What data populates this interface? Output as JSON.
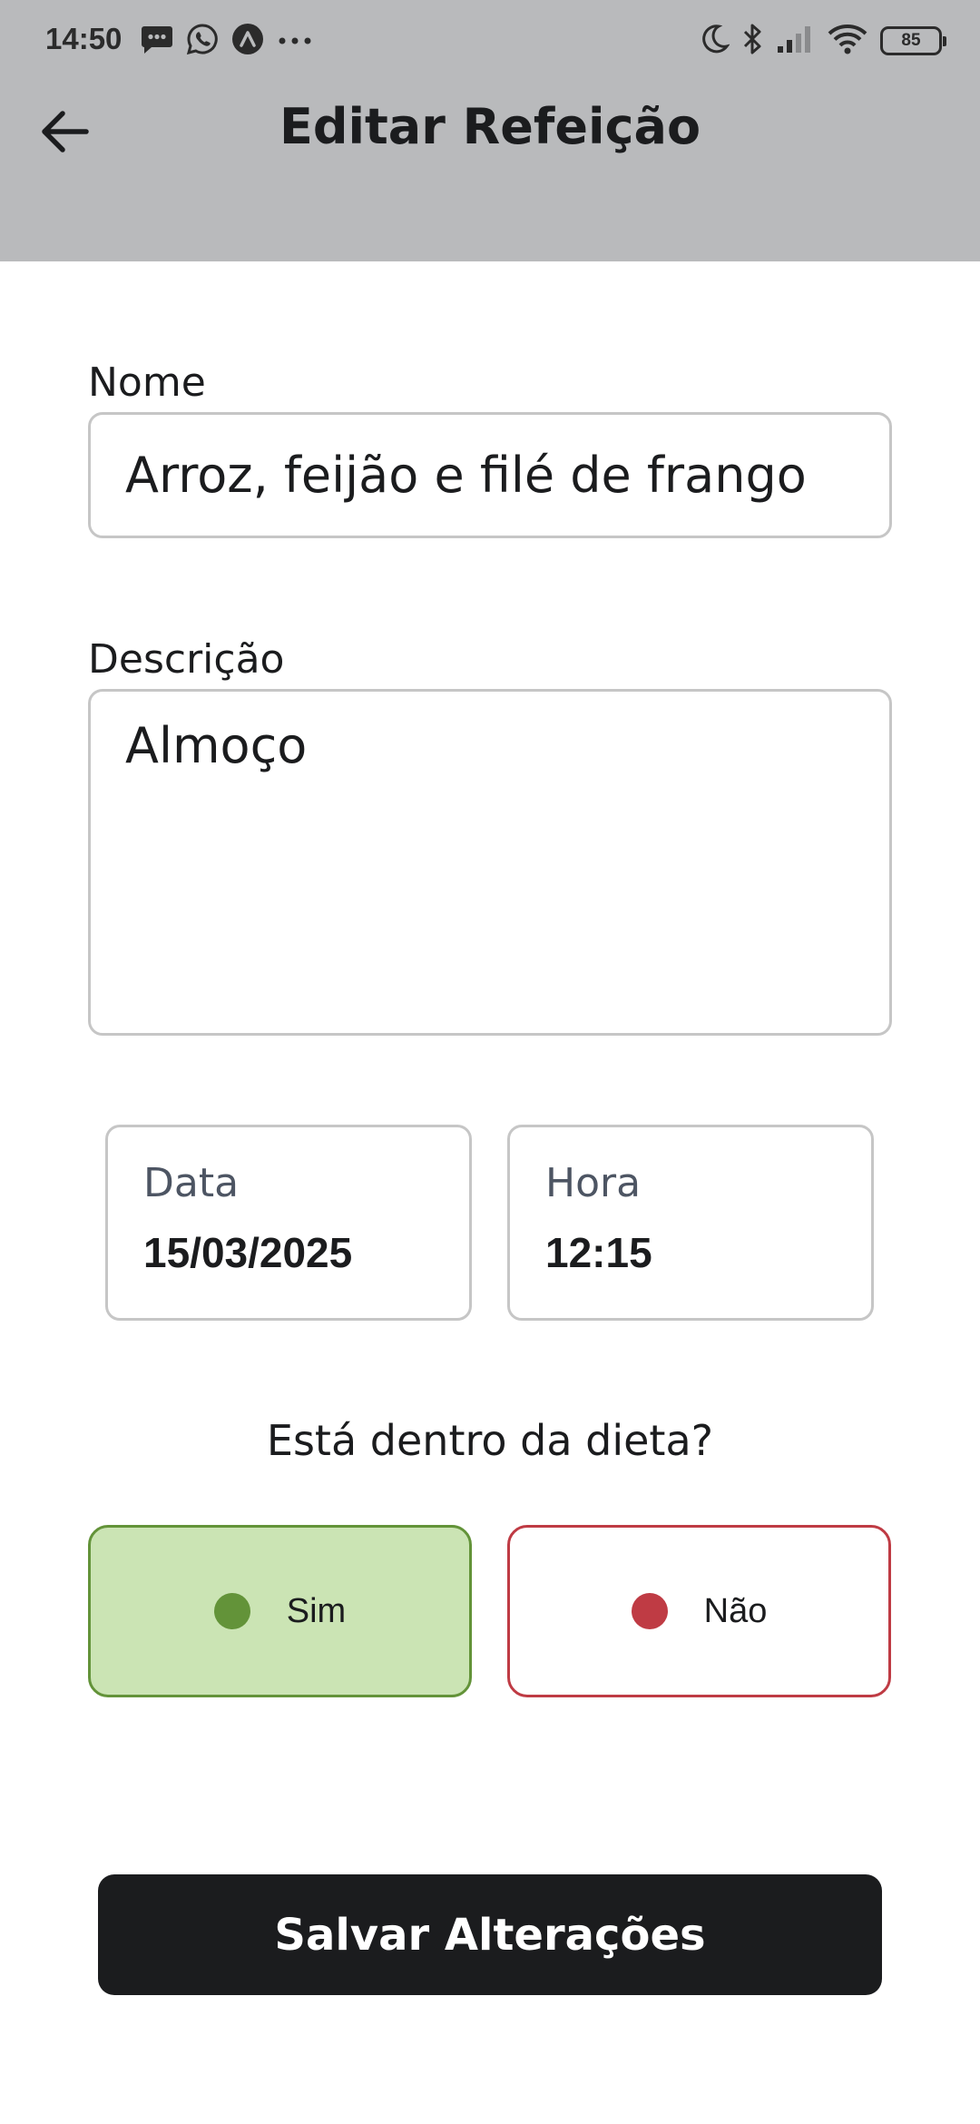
{
  "status_bar": {
    "time": "14:50",
    "left_icons": [
      "message-icon",
      "whatsapp-icon",
      "app-notification-icon",
      "more-icon"
    ],
    "right_icons": [
      "moon-icon",
      "bluetooth-icon",
      "signal-icon",
      "wifi-icon",
      "battery-icon"
    ],
    "battery": "85"
  },
  "header": {
    "title": "Editar Refeição",
    "back_icon": "arrow-left-icon",
    "background": "#b9babc"
  },
  "form": {
    "name": {
      "label": "Nome",
      "value": "Arroz, feijão e filé de frango"
    },
    "description": {
      "label": "Descrição",
      "value": "Almoço"
    },
    "date": {
      "label": "Data",
      "value": "15/03/2025"
    },
    "time": {
      "label": "Hora",
      "value": "12:15"
    },
    "diet_question": "Está dentro da dieta?",
    "options": [
      {
        "label": "Sim",
        "selected": true,
        "dot_color": "#639339",
        "background": "#cbe4b4",
        "border": "#639339"
      },
      {
        "label": "Não",
        "selected": false,
        "dot_color": "#bf3b44",
        "background": "#ffffff",
        "border": "#bf3b44"
      }
    ]
  },
  "save_button": {
    "label": "Salvar Alterações",
    "background": "#1b1c1e"
  }
}
